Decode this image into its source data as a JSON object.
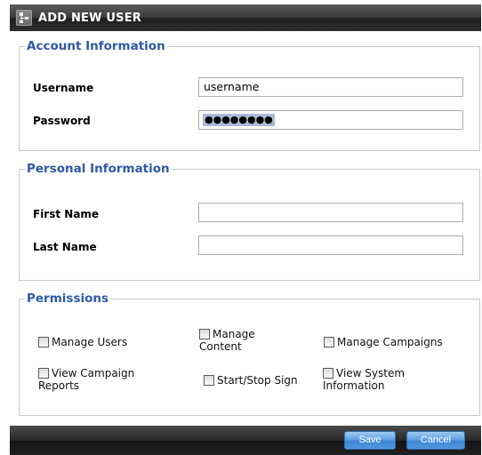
{
  "dialog": {
    "title": "ADD NEW USER",
    "title_icon": "hierarchy-icon"
  },
  "account": {
    "legend": "Account Information",
    "username_label": "Username",
    "username_value": "username",
    "password_label": "Password",
    "password_mask": "●●●●●●●●"
  },
  "personal": {
    "legend": "Personal Information",
    "first_name_label": "First Name",
    "first_name_value": "",
    "last_name_label": "Last Name",
    "last_name_value": ""
  },
  "permissions": {
    "legend": "Permissions",
    "items": [
      {
        "line1": "Manage Users",
        "line2": "",
        "checked": false
      },
      {
        "line1": "Manage",
        "line2": "Content",
        "checked": false
      },
      {
        "line1": "Manage Campaigns",
        "line2": "",
        "checked": false
      },
      {
        "line1": "View Campaign",
        "line2": "Reports",
        "checked": false
      },
      {
        "line1": "Start/Stop Sign",
        "line2": "",
        "checked": false
      },
      {
        "line1": "View System",
        "line2": "Information",
        "checked": false
      }
    ]
  },
  "footer": {
    "save_label": "Save",
    "cancel_label": "Cancel"
  },
  "colors": {
    "legend_blue": "#2d5aa7",
    "button_blue": "#4f95dc",
    "title_bar": "#2c2c2c"
  }
}
